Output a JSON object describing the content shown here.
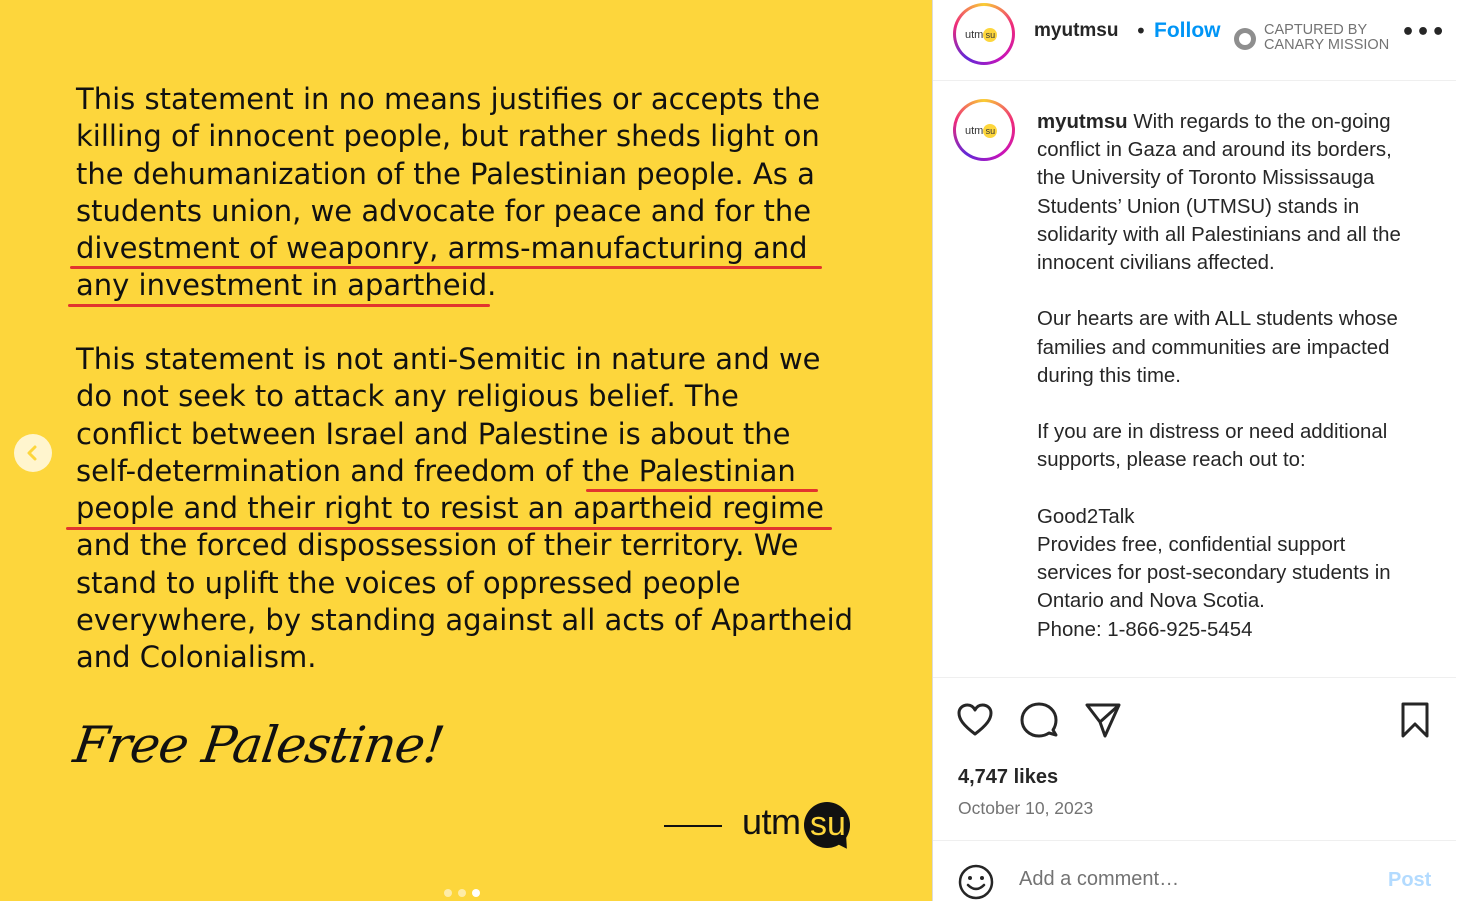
{
  "image_post": {
    "paragraph_1": "This statement in no means justifies or accepts the\nkilling of innocent people, but rather sheds light on\nthe dehumanization of the Palestinian people. As a\nstudents union, we advocate for peace and for the\ndivestment of weaponry, arms-manufacturing and\nany investment in apartheid.",
    "paragraph_2": "This statement is not anti-Semitic in nature and we\ndo not seek to attack any religious belief. The\nconflict between Israel and Palestine is about the\nself-determination and freedom of the Palestinian\npeople and their right to resist an apartheid regime\nand the forced dispossession of their territory. We\nstand to uplift the voices of oppressed people\neverywhere, by standing against all acts of Apartheid\nand Colonialism.",
    "signature": "Free Palestine!",
    "logo_text_main": "utm",
    "logo_text_badge": "su",
    "highlight_color": "#e2342e",
    "background_color": "#fdd63c",
    "carousel_prev_icon": "chevron-left-icon",
    "carousel_total_slides": 3,
    "carousel_active_slide": 3
  },
  "header": {
    "avatar_logo_main": "utm",
    "avatar_logo_badge": "su",
    "username": "myutmsu",
    "separator": "•",
    "follow_label": "Follow",
    "watermark_line_1": "CAPTURED BY",
    "watermark_line_2": "CANARY MISSION",
    "more_icon": "more-horizontal-icon",
    "more_label": "•••"
  },
  "caption": {
    "username": "myutmsu",
    "text": " With regards to the on-going conflict in Gaza and around its borders, the University of Toronto Mississauga Students’ Union (UTMSU) stands in solidarity with all Palestinians and all the innocent civilians affected.\n\nOur hearts are with ALL students whose families and communities are impacted during this time.\n\nIf you are in distress or need additional supports, please reach out to:\n\nGood2Talk\nProvides free, confidential support services for post-secondary students in Ontario and Nova Scotia.\nPhone: 1-866-925-5454"
  },
  "actions": {
    "like_icon": "heart-icon",
    "comment_icon": "comment-icon",
    "share_icon": "share-icon",
    "save_icon": "bookmark-icon",
    "likes": "4,747 likes",
    "date": "October 10, 2023"
  },
  "comment": {
    "emoji_icon": "emoji-icon",
    "placeholder": "Add a comment…",
    "post_label": "Post"
  },
  "colors": {
    "accent": "#0095f6",
    "post_disabled": "#b3dbff"
  }
}
